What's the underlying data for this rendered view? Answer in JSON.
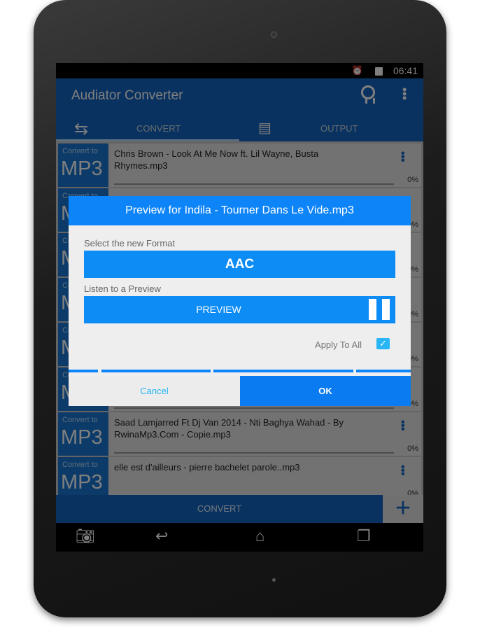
{
  "status": {
    "time": "06:41",
    "alarm_icon": "alarm-icon",
    "battery_icon": "battery-icon"
  },
  "app": {
    "title": "Audiator Converter",
    "award_icon": "award-icon",
    "menu_icon": "overflow-menu-icon"
  },
  "tabs": [
    {
      "label": "CONVERT",
      "icon": "convert-arrows-icon",
      "active": true
    },
    {
      "label": "OUTPUT",
      "icon": "folder-stack-icon",
      "active": false
    }
  ],
  "list": [
    {
      "convert_to": "Convert to",
      "format": "MP3",
      "name": "Chris Brown - Look At Me Now ft. Lil Wayne, Busta Rhymes.mp3",
      "progress": "0%"
    },
    {
      "convert_to": "Convert to",
      "format": "MP3",
      "name": "",
      "progress": "0%"
    },
    {
      "convert_to": "Convert to",
      "format": "MP3",
      "name": "",
      "progress": "0%"
    },
    {
      "convert_to": "Convert to",
      "format": "MP3",
      "name": "",
      "progress": "0%"
    },
    {
      "convert_to": "Convert to",
      "format": "MP3",
      "name": "",
      "progress": "0%"
    },
    {
      "convert_to": "Convert to",
      "format": "MP3",
      "name": "",
      "progress": "0%"
    },
    {
      "convert_to": "Convert to",
      "format": "MP3",
      "name": "Saad Lamjarred Ft Dj Van 2014 - Nti Baghya Wahad - By RwinaMp3.Com - Copie.mp3",
      "progress": "0%"
    },
    {
      "convert_to": "Convert to",
      "format": "MP3",
      "name": "elle est d'ailleurs - pierre bachelet parole..mp3",
      "progress": "0%"
    }
  ],
  "bottom": {
    "convert_label": "CONVERT",
    "add_icon": "plus-icon"
  },
  "dialog": {
    "title": "Preview for Indila - Tourner Dans Le Vide.mp3",
    "format_label": "Select the new Format",
    "format_value": "AAC",
    "preview_label": "Listen to a Preview",
    "preview_button": "PREVIEW",
    "pause_icon": "pause-icon",
    "apply_all_label": "Apply To All",
    "apply_all_checked": true,
    "cancel": "Cancel",
    "ok": "OK"
  },
  "colors": {
    "accent": "#0d84f7",
    "appbar": "#1565c0"
  }
}
